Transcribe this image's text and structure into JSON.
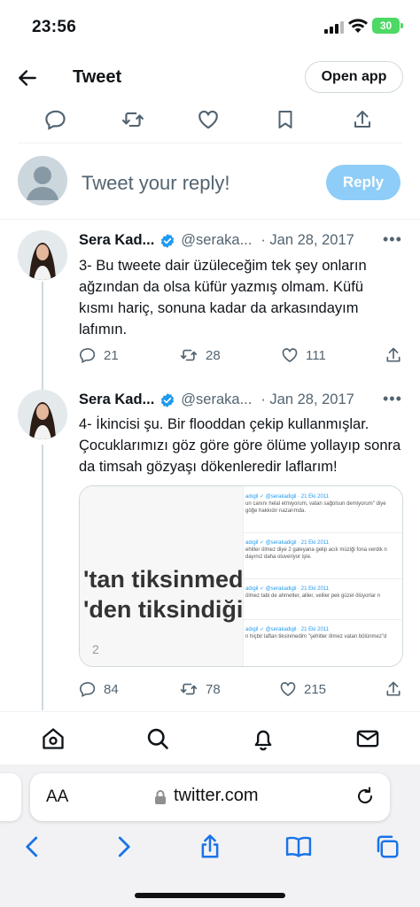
{
  "status_bar": {
    "time": "23:56",
    "battery": "30"
  },
  "header": {
    "title": "Tweet",
    "open_app": "Open app"
  },
  "composer": {
    "placeholder": "Tweet your reply!",
    "reply_label": "Reply"
  },
  "tweets": [
    {
      "name": "Sera Kad...",
      "handle": "@seraka...",
      "date": "· Jan 28, 2017",
      "text": "3- Bu tweete dair üzüleceğim tek şey onların ağzından da olsa küfür yazmış olmam. Küfü kısmı hariç, sonuna kadar da arkasındayım lafımın.",
      "replies": "21",
      "retweets": "28",
      "likes": "111"
    },
    {
      "name": "Sera Kad...",
      "handle": "@seraka...",
      "date": "· Jan 28, 2017",
      "text": "4- İkincisi şu. Bir flooddan çekip kullanmışlar. Çocuklarımızı göz göre göre ölüme yollayıp sonra da timsah gözyaşı dökenleredir laflarım!",
      "replies": "84",
      "retweets": "78",
      "likes": "215",
      "media": {
        "left_lines": [
          "'tan tiksinmedim",
          "'den tiksindiğim"
        ],
        "left_page": "2",
        "right_rows": [
          {
            "head": "adıgil ✓ @serakadigil · 21 Eki 2011",
            "text": "un canını helal etmiyorum, vatan sağolsun demiyorum\" diye",
            "text2": "göğe hakkıdır nazarımda."
          },
          {
            "head": "adıgil ✓ @serakadigil · 21 Eki 2011",
            "text": "ehitler ölmez diye 2 galeyana gelip acılı müziği fona verdik n",
            "text2": "dayınız daha oluveriyor işte."
          },
          {
            "head": "adıgil ✓ @serakadigil · 21 Eki 2011",
            "text": "ölmez tabi de ahmetler, aliler, veliler pek güzel ölüyorlar n",
            "text2": ""
          },
          {
            "head": "adıgil ✓ @serakadigil · 21 Eki 2011",
            "text": "n hiçbir laftan tiksinmedim \"şehitler ölmez vatan bölünmez\"d",
            "text2": ""
          }
        ]
      }
    }
  ],
  "safari": {
    "url": "twitter.com",
    "aa_label": "AA"
  },
  "colors": {
    "accent": "#1d9bf0",
    "reply_disabled": "#8ecdf8",
    "safari_blue": "#1a73e8"
  }
}
